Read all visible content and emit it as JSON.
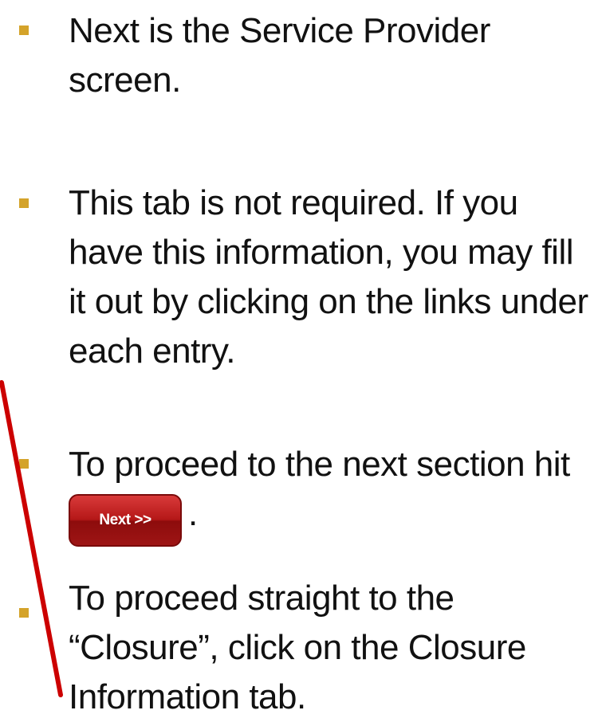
{
  "bullets": [
    {
      "lines": [
        "Next is the Service Provider",
        "screen."
      ]
    },
    {
      "lines": [
        "This tab is not required. If you",
        "have this information, you may fill",
        "it out by clicking on the links under",
        "each entry."
      ]
    },
    {
      "lines": [
        "To proceed to the next section hit"
      ],
      "button_label": "Next >>",
      "trailing": "."
    },
    {
      "lines": [
        "To proceed straight to the",
        "“Closure”, click on the Closure",
        "Information tab."
      ]
    }
  ],
  "colors": {
    "bullet": "#d4a32a",
    "arrow": "#cc0000",
    "button": "#b51818"
  }
}
